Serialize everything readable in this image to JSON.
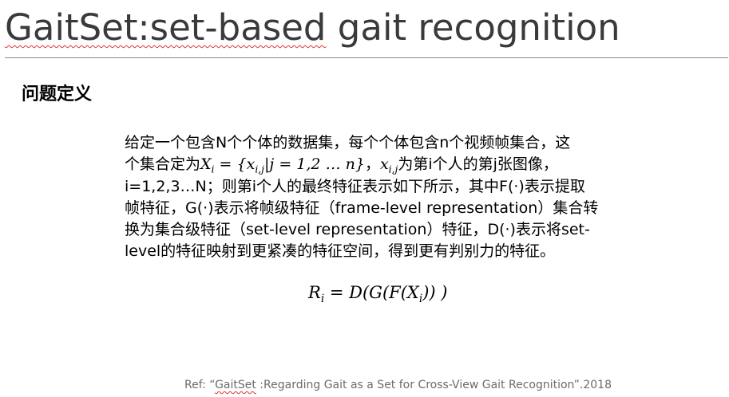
{
  "title": {
    "part1": "GaitSet:set-based",
    "part2": " gait recognition"
  },
  "section_heading": "问题定义",
  "definition": {
    "line1": "给定一个包含N个个体的数据集，每个个体包含n个视频帧集合，这",
    "line2_a": "个集合定为",
    "line2_math1": "X",
    "line2_math1_sub": "i",
    "line2_math2": " = {x",
    "line2_math2_sub": "i,j",
    "line2_math3": "|j = 1,2 … n}",
    "line2_b": "，",
    "line2_math4": "x",
    "line2_math4_sub": "i,j",
    "line2_c": "为第i个人的第j张图像，",
    "line3": "i=1,2,3…N；则第i个人的最终特征表示如下所示，其中F(·)表示提取",
    "line4": "帧特征，G(·)表示将帧级特征（frame-level representation）集合转",
    "line5": "换为集合级特征（set-level representation）特征，D(·)表示将set-",
    "line6": "level的特征映射到更紧凑的特征空间，得到更有判别力的特征。"
  },
  "formula": {
    "lhs": "R",
    "lhs_sub": "i",
    "rhs_a": " = D(G(F(X",
    "rhs_sub": "i",
    "rhs_b": ")) )"
  },
  "reference": {
    "prefix": "Ref: “",
    "underlined": "GaitSet",
    "suffix": " :Regarding Gait as a Set for Cross-View Gait Recognition”.2018"
  }
}
